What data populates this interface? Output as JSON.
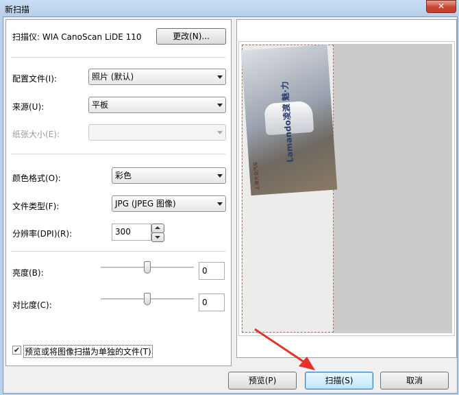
{
  "window": {
    "title": "新扫描",
    "close_glyph": "✕"
  },
  "scanner": {
    "label": "扫描仪: WIA CanoScan LiDE 110",
    "change_button": "更改(N)..."
  },
  "settings": {
    "profile": {
      "label": "配置文件(I):",
      "value": "照片 (默认)"
    },
    "source": {
      "label": "来源(U):",
      "value": "平板"
    },
    "paper_size": {
      "label": "纸张大小(E):",
      "value": ""
    },
    "color_format": {
      "label": "颜色格式(O):",
      "value": "彩色"
    },
    "file_type": {
      "label": "文件类型(F):",
      "value": "JPG (JPEG 图像)"
    },
    "resolution": {
      "label": "分辨率(DPI)(R):",
      "value": "300"
    },
    "brightness": {
      "label": "亮度(B):",
      "value": "0",
      "level": 0
    },
    "contrast": {
      "label": "对比度(C):",
      "value": "0",
      "level": 0
    }
  },
  "options": {
    "separate_files": {
      "label": "预览或将图像扫描为单独的文件(T)",
      "checked": true
    }
  },
  "preview": {
    "ad_text": "Lamando凌渡 魅·力",
    "ad_brand": "上海大众汽车"
  },
  "footer": {
    "preview_button": "预览(P)",
    "scan_button": "扫描(S)",
    "cancel_button": "取消"
  },
  "colors": {
    "annotation_arrow": "#e8302a",
    "titlebar": "#c9def5",
    "close_button": "#c8452f"
  }
}
